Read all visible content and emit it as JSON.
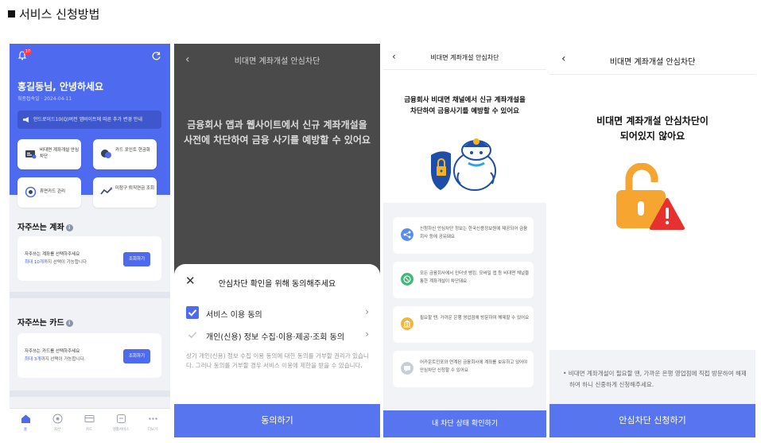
{
  "page": {
    "heading": "서비스 신청방법"
  },
  "screen1": {
    "badge": "10",
    "greeting": "홍길동님, 안녕하세요",
    "last_login": "최종접속일 · 2024-04-11",
    "notice": "안드로이드10(Q)버전 앱바이트에 따른 추가 변경 안내",
    "quick_menu": [
      {
        "label": "비대면 계좌개설 안심차단",
        "icon": "id-card-icon"
      },
      {
        "label": "카드 포인트 현금화",
        "icon": "coin-icon"
      },
      {
        "label": "휴면카드 관리",
        "icon": "card-manage-icon"
      },
      {
        "label": "미청구 퇴직연금 조회",
        "icon": "pension-icon"
      }
    ],
    "accounts": {
      "title": "자주쓰는 계좌",
      "line1": "자주쓰는 계좌를 선택하주세요",
      "line2_highlight": "최대 10개",
      "line2_rest": "까지 선택이 가능합니다",
      "button": "조회하기"
    },
    "cards": {
      "title": "자주쓰는 카드",
      "line1": "자주쓰는 카드를 선택하주세요",
      "line2_highlight": "최대 3개",
      "line2_rest": "까지 선택이 가능합니다.",
      "button": "조회하기"
    },
    "tabs": [
      "홈",
      "자산",
      "카드",
      "생활서비스",
      "더보기"
    ],
    "colors": {
      "primary": "#4e6bf0"
    }
  },
  "screen2": {
    "nav_title": "비대면 계좌개설 안심차단",
    "hero_line1": "금융회사 앱과 웹사이트에서 신규 계좌개설을",
    "hero_line2": "사전에 차단하여 금융 사기를 예방할 수 있어요",
    "sheet_title": "안심차단 확인을 위해 동의해주세요",
    "consents": [
      {
        "label": "서비스 이용 동의",
        "checked": true
      },
      {
        "label": "개인(신용) 정보 수집·이용·제공·조회 동의",
        "checked": false
      }
    ],
    "description": "상기 개인(신용) 정보 수집 이용 동의에 대한 동의를 거부할 권리가 있습니다. 그러나 동의를 거부할 경우 서비스 이용에 제한을 받을 수 있습니다.",
    "agree_button": "동의하기"
  },
  "screen3": {
    "nav_title": "비대면 계좌개설 안심차단",
    "hero_line1": "금융회사 비대면 채널에서 신규 계좌개설을",
    "hero_line2": "차단하여 금융사기를 예방할 수 있어요",
    "items": [
      {
        "text": "신청하신 안심차단 정보는 한국신용정보원에 제공되어 금융회사 등에 공유돼요",
        "icon": "share-icon"
      },
      {
        "text": "모든 금융회사에서 인터넷 뱅킹, 모바일 앱 등 비대면 채널을 통한 계좌개설이 차단돼요",
        "icon": "block-icon"
      },
      {
        "text": "필요할 땐, 가까운 은행 영업점에 방문하여 해제할 수 있어요",
        "icon": "bank-icon"
      },
      {
        "text": "어카운트인포와 연계된 금융회사에 계좌를 보유하고 있어야 안심차단 신청할 수 있어요",
        "icon": "chat-icon"
      }
    ],
    "status_button": "내 차단 상태 확인하기"
  },
  "screen4": {
    "nav_title": "비대면 계좌개설 안심차단",
    "hero_line1": "비대면 계좌개설 안심차단이",
    "hero_line2": "되어있지 않아요",
    "note": "• 비대면 계좌개설이 필요할 땐, 가까운 은행 영업점에 직접 방문하여 해제하여 하니 신중하게 신청해주세요.",
    "apply_button": "안심차단 신청하기"
  }
}
